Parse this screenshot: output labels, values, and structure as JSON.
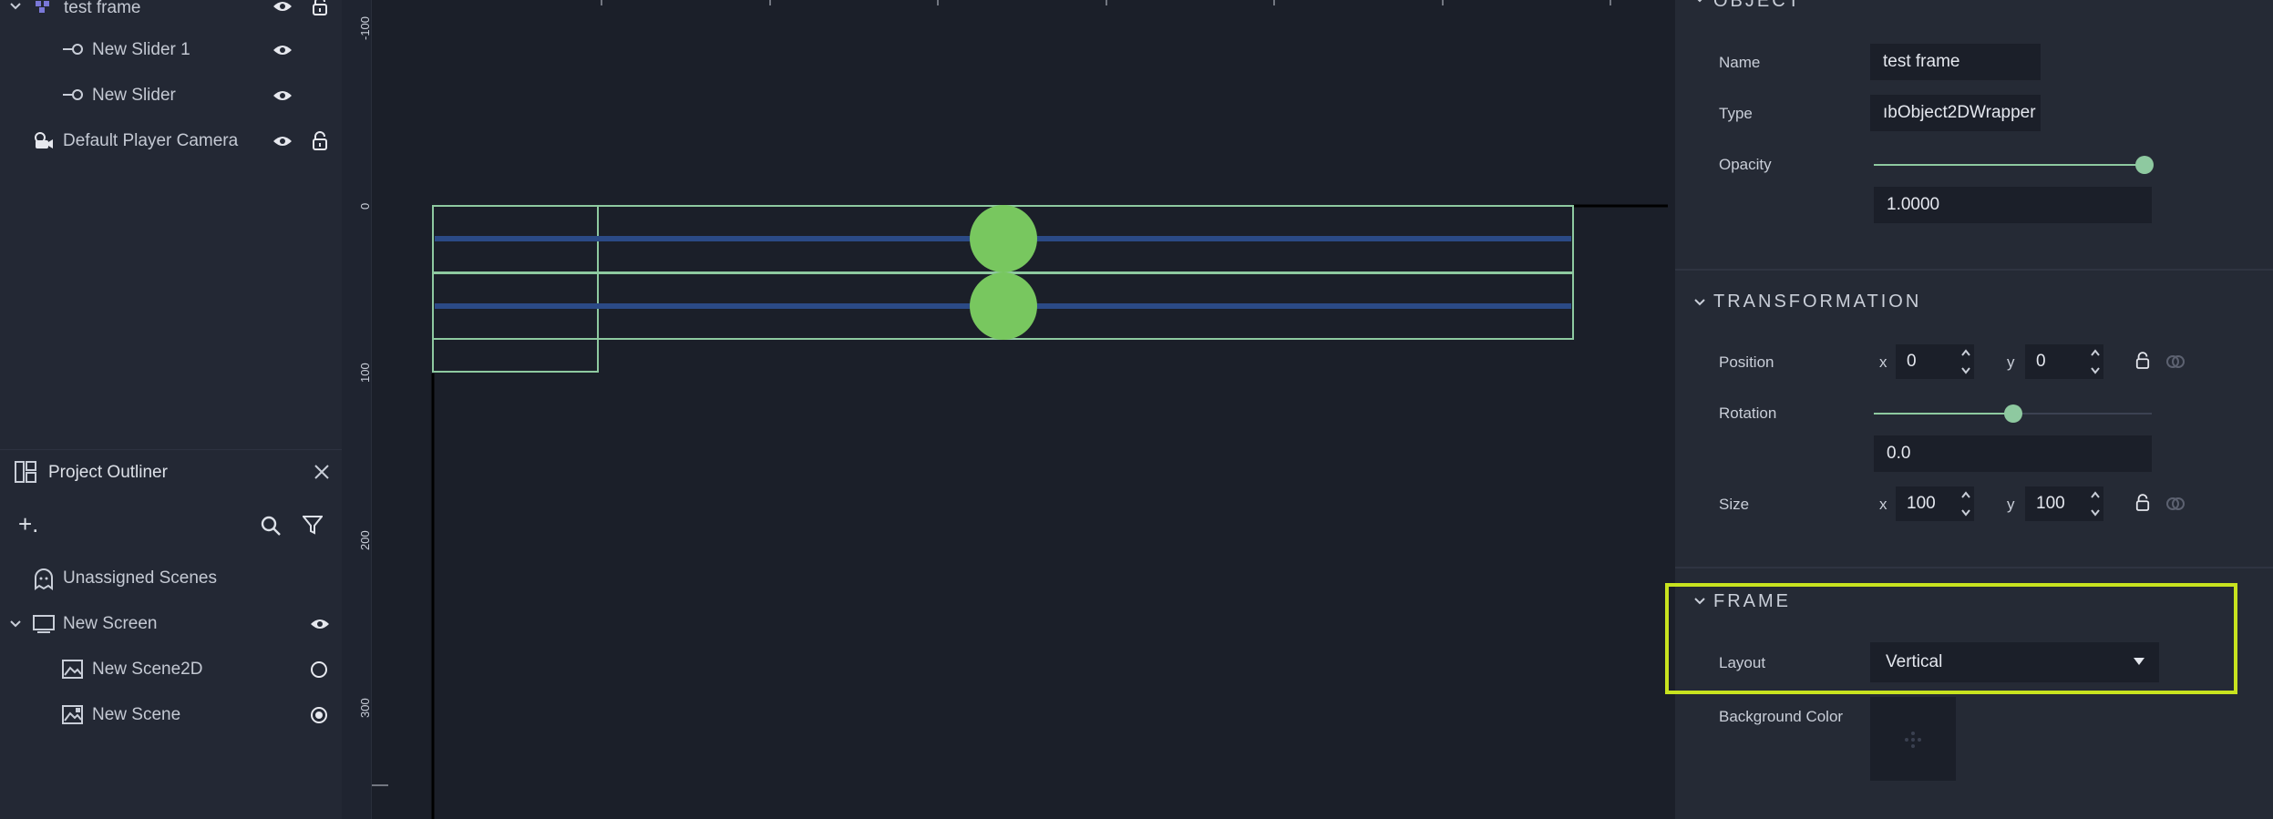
{
  "hierarchy": {
    "items": [
      {
        "label": "test frame"
      },
      {
        "label": "New Slider 1"
      },
      {
        "label": "New Slider"
      },
      {
        "label": "Default Player Camera"
      }
    ]
  },
  "outliner": {
    "title": "Project Outliner",
    "add_label": "+.",
    "items": [
      {
        "label": "Unassigned Scenes"
      },
      {
        "label": "New Screen"
      },
      {
        "label": "New Scene2D"
      },
      {
        "label": "New Scene"
      }
    ]
  },
  "ruler": {
    "ticks": [
      "-100",
      "0",
      "100",
      "200",
      "300"
    ]
  },
  "inspector": {
    "object": {
      "header": "OBJECT",
      "name_label": "Name",
      "name_value": "test frame",
      "type_label": "Type",
      "type_value": "ıbObject2DWrapper",
      "opacity_label": "Opacity",
      "opacity_value": "1.0000",
      "opacity_fraction": 1.0
    },
    "transformation": {
      "header": "TRANSFORMATION",
      "position_label": "Position",
      "position_x": "0",
      "position_y": "0",
      "rotation_label": "Rotation",
      "rotation_value": "0.0",
      "rotation_fraction": 0.5,
      "size_label": "Size",
      "size_x": "100",
      "size_y": "100",
      "axis_x": "x",
      "axis_y": "y"
    },
    "frame": {
      "header": "FRAME",
      "layout_label": "Layout",
      "layout_value": "Vertical",
      "bgcolor_label": "Background Color"
    }
  },
  "colors": {
    "accent": "#8ec9a0",
    "highlight": "#c8e31f",
    "slider_handle": "#78c75f",
    "slider_track": "#2b4a86"
  }
}
